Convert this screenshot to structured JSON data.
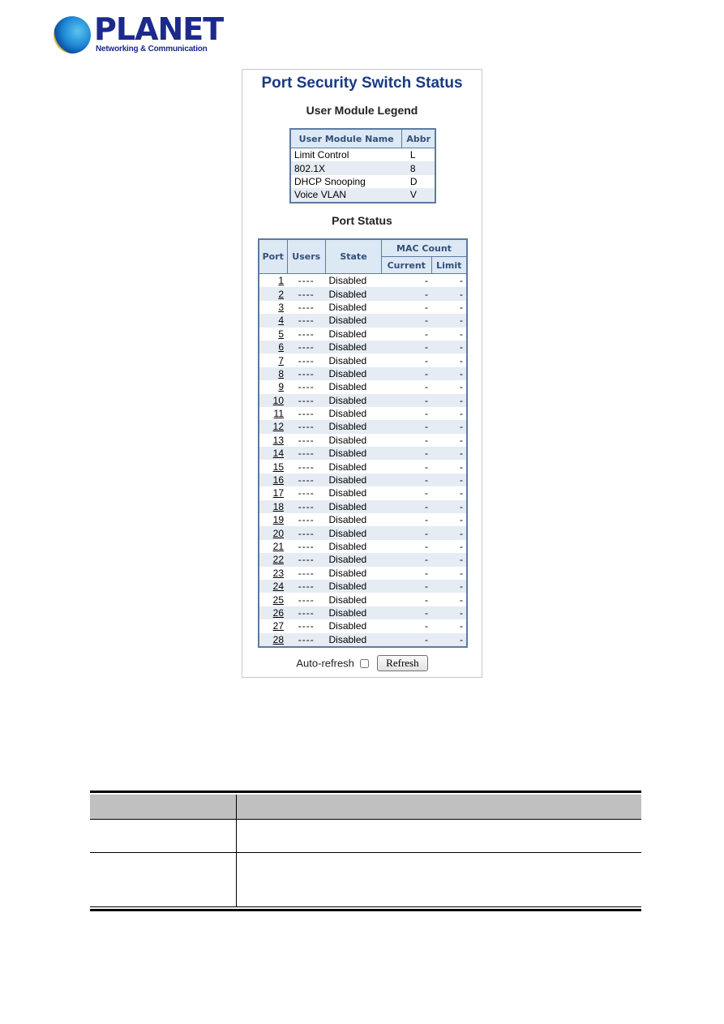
{
  "logo": {
    "name": "PLANET",
    "tagline": "Networking & Communication"
  },
  "panel": {
    "title": "Port Security Switch Status",
    "legend": {
      "title": "User Module Legend",
      "headers": [
        "User Module Name",
        "Abbr"
      ],
      "rows": [
        {
          "name": "Limit Control",
          "abbr": "L"
        },
        {
          "name": "802.1X",
          "abbr": "8"
        },
        {
          "name": "DHCP Snooping",
          "abbr": "D"
        },
        {
          "name": "Voice VLAN",
          "abbr": "V"
        }
      ]
    },
    "port_status": {
      "title": "Port Status",
      "headers": {
        "port": "Port",
        "users": "Users",
        "state": "State",
        "mac_count": "MAC Count",
        "current": "Current",
        "limit": "Limit"
      },
      "rows": [
        {
          "port": "1",
          "users": "----",
          "state": "Disabled",
          "current": "-",
          "limit": "-"
        },
        {
          "port": "2",
          "users": "----",
          "state": "Disabled",
          "current": "-",
          "limit": "-"
        },
        {
          "port": "3",
          "users": "----",
          "state": "Disabled",
          "current": "-",
          "limit": "-"
        },
        {
          "port": "4",
          "users": "----",
          "state": "Disabled",
          "current": "-",
          "limit": "-"
        },
        {
          "port": "5",
          "users": "----",
          "state": "Disabled",
          "current": "-",
          "limit": "-"
        },
        {
          "port": "6",
          "users": "----",
          "state": "Disabled",
          "current": "-",
          "limit": "-"
        },
        {
          "port": "7",
          "users": "----",
          "state": "Disabled",
          "current": "-",
          "limit": "-"
        },
        {
          "port": "8",
          "users": "----",
          "state": "Disabled",
          "current": "-",
          "limit": "-"
        },
        {
          "port": "9",
          "users": "----",
          "state": "Disabled",
          "current": "-",
          "limit": "-"
        },
        {
          "port": "10",
          "users": "----",
          "state": "Disabled",
          "current": "-",
          "limit": "-"
        },
        {
          "port": "11",
          "users": "----",
          "state": "Disabled",
          "current": "-",
          "limit": "-"
        },
        {
          "port": "12",
          "users": "----",
          "state": "Disabled",
          "current": "-",
          "limit": "-"
        },
        {
          "port": "13",
          "users": "----",
          "state": "Disabled",
          "current": "-",
          "limit": "-"
        },
        {
          "port": "14",
          "users": "----",
          "state": "Disabled",
          "current": "-",
          "limit": "-"
        },
        {
          "port": "15",
          "users": "----",
          "state": "Disabled",
          "current": "-",
          "limit": "-"
        },
        {
          "port": "16",
          "users": "----",
          "state": "Disabled",
          "current": "-",
          "limit": "-"
        },
        {
          "port": "17",
          "users": "----",
          "state": "Disabled",
          "current": "-",
          "limit": "-"
        },
        {
          "port": "18",
          "users": "----",
          "state": "Disabled",
          "current": "-",
          "limit": "-"
        },
        {
          "port": "19",
          "users": "----",
          "state": "Disabled",
          "current": "-",
          "limit": "-"
        },
        {
          "port": "20",
          "users": "----",
          "state": "Disabled",
          "current": "-",
          "limit": "-"
        },
        {
          "port": "21",
          "users": "----",
          "state": "Disabled",
          "current": "-",
          "limit": "-"
        },
        {
          "port": "22",
          "users": "----",
          "state": "Disabled",
          "current": "-",
          "limit": "-"
        },
        {
          "port": "23",
          "users": "----",
          "state": "Disabled",
          "current": "-",
          "limit": "-"
        },
        {
          "port": "24",
          "users": "----",
          "state": "Disabled",
          "current": "-",
          "limit": "-"
        },
        {
          "port": "25",
          "users": "----",
          "state": "Disabled",
          "current": "-",
          "limit": "-"
        },
        {
          "port": "26",
          "users": "----",
          "state": "Disabled",
          "current": "-",
          "limit": "-"
        },
        {
          "port": "27",
          "users": "----",
          "state": "Disabled",
          "current": "-",
          "limit": "-"
        },
        {
          "port": "28",
          "users": "----",
          "state": "Disabled",
          "current": "-",
          "limit": "-"
        }
      ]
    },
    "controls": {
      "auto_refresh_label": "Auto-refresh",
      "auto_refresh_checked": false,
      "refresh_label": "Refresh"
    }
  },
  "colors": {
    "title": "#1a3a82",
    "header_bg": "#dde8f5",
    "header_text": "#33507a",
    "border": "#5b7aa2",
    "row_alt": "#e6ecf3",
    "desc_header": "#c0c0c0"
  }
}
